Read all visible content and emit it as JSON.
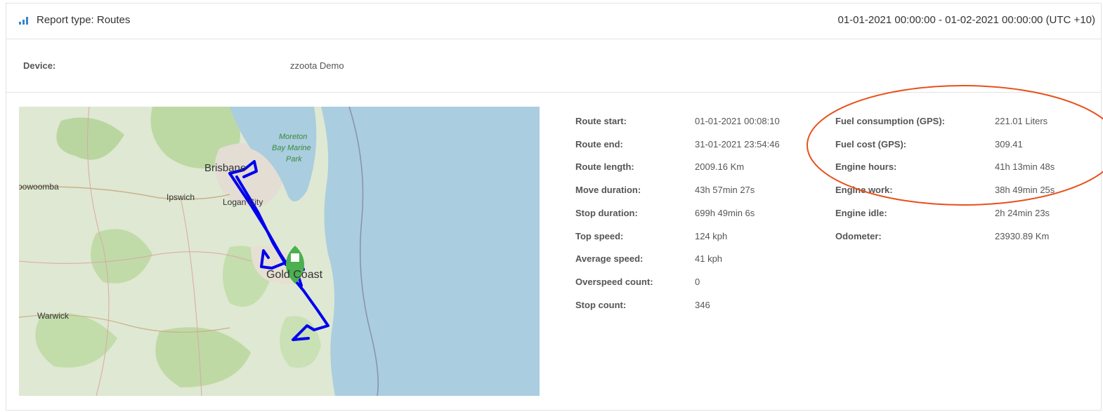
{
  "header": {
    "icon": "bar-chart-icon",
    "title": "Report type: Routes",
    "date_range": "01-01-2021 00:00:00 - 01-02-2021 00:00:00 (UTC +10)"
  },
  "device": {
    "label": "Device:",
    "value": "zzoota Demo"
  },
  "map": {
    "labels": {
      "moreton": "Moreton",
      "bay_marine": "Bay Marine",
      "park": "Park",
      "brisbane": "Brisbane",
      "toowoomba": "Toowoomba",
      "ipswich": "Ipswich",
      "logan_city": "Logan City",
      "gold_coast": "Gold Coast",
      "warwick": "Warwick"
    },
    "colors": {
      "route": "#0000ee",
      "marker": "#4caf50",
      "sea": "#aacde0",
      "land": "#dfe8d2"
    }
  },
  "stats_left": [
    {
      "label": "Route start:",
      "value": "01-01-2021 00:08:10"
    },
    {
      "label": "Route end:",
      "value": "31-01-2021 23:54:46"
    },
    {
      "label": "Route length:",
      "value": "2009.16 Km"
    },
    {
      "label": "Move duration:",
      "value": "43h 57min 27s"
    },
    {
      "label": "Stop duration:",
      "value": "699h 49min 6s"
    },
    {
      "label": "Top speed:",
      "value": "124 kph"
    },
    {
      "label": "Average speed:",
      "value": "41 kph"
    },
    {
      "label": "Overspeed count:",
      "value": "0"
    },
    {
      "label": "Stop count:",
      "value": "346"
    }
  ],
  "stats_right": [
    {
      "label": "Fuel consumption (GPS):",
      "value": "221.01 Liters"
    },
    {
      "label": "Fuel cost (GPS):",
      "value": "309.41"
    },
    {
      "label": "Engine hours:",
      "value": "41h 13min 48s"
    },
    {
      "label": "Engine work:",
      "value": "38h 49min 25s"
    },
    {
      "label": "Engine idle:",
      "value": "2h 24min 23s"
    },
    {
      "label": "Odometer:",
      "value": "23930.89 Km"
    }
  ],
  "annotation": {
    "color": "#e8501a"
  }
}
